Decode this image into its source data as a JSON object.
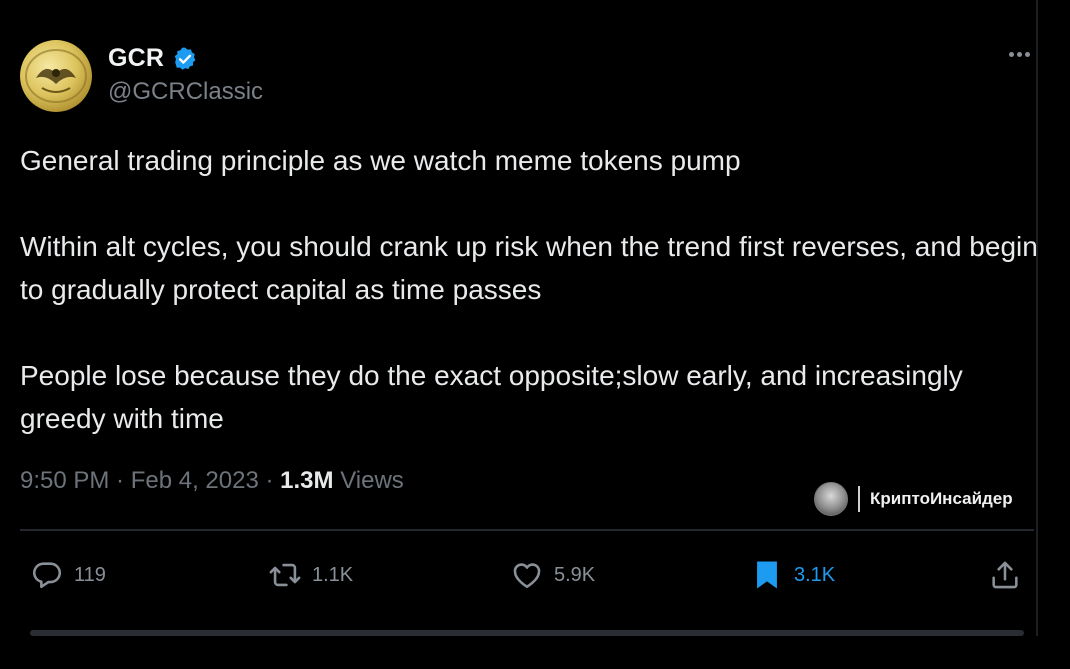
{
  "author": {
    "display_name": "GCR",
    "handle": "@GCRClassic",
    "verified": true
  },
  "tweet": {
    "paragraphs": [
      "General trading principle as we watch meme tokens pump",
      "Within alt cycles, you should crank up risk when the trend first reverses, and begin to gradually protect capital as time passes",
      "People lose because they do the exact opposite;slow early, and increasingly greedy with time"
    ],
    "time": "9:50 PM",
    "separator": " · ",
    "date": "Feb 4, 2023",
    "views_count": "1.3M",
    "views_label": "Views"
  },
  "actions": {
    "reply_count": "119",
    "retweet_count": "1.1K",
    "like_count": "5.9K",
    "bookmark_count": "3.1K"
  },
  "watermark": {
    "text": "КриптоИнсайдер"
  },
  "colors": {
    "background": "#000000",
    "verified": "#1d9bf0",
    "bookmark_active": "#1d9bf0",
    "muted_text": "#6d737a"
  },
  "icons": [
    "verified-badge-icon",
    "more-options-icon",
    "reply-icon",
    "retweet-icon",
    "like-icon",
    "bookmark-icon",
    "share-icon"
  ]
}
